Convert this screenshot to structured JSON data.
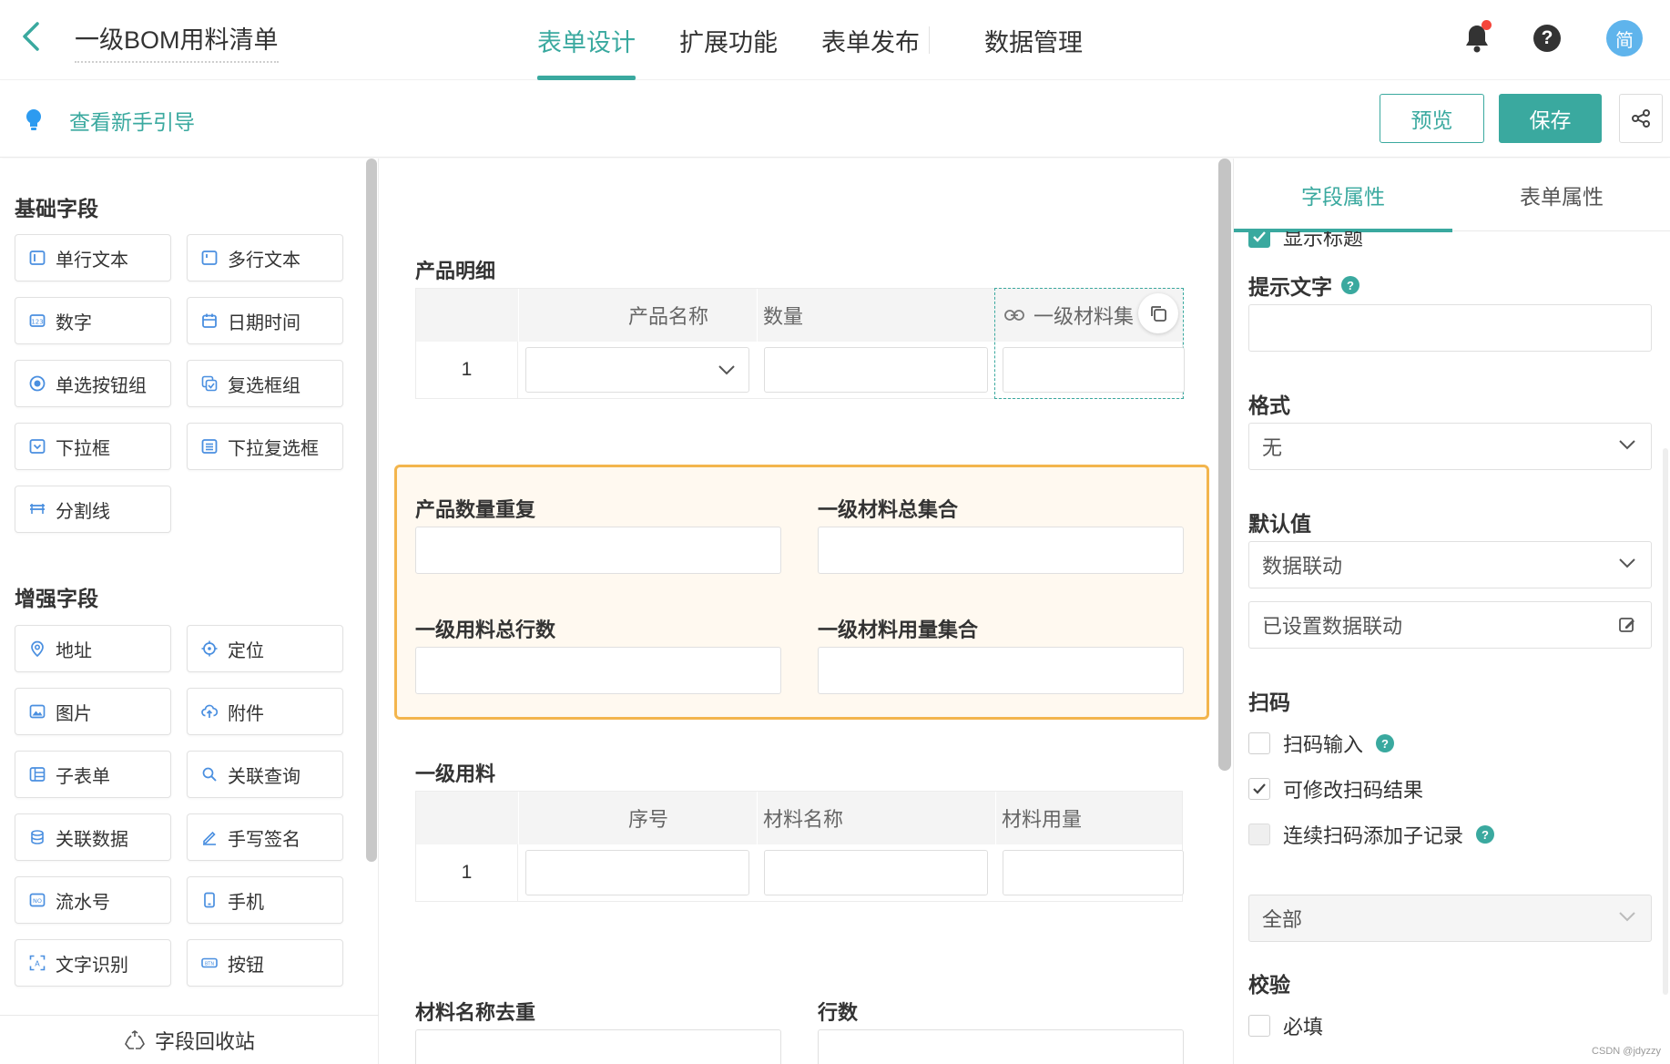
{
  "header": {
    "title": "一级BOM用料清单",
    "tabs": [
      {
        "label": "表单设计",
        "active": true
      },
      {
        "label": "扩展功能",
        "active": false
      },
      {
        "label": "表单发布",
        "active": false
      }
    ],
    "data_tab": "数据管理",
    "help_glyph": "?",
    "avatar_text": "简",
    "accent_color": "#3aa99f",
    "notification_dot_color": "#f5463b"
  },
  "subbar": {
    "guide_text": "查看新手引导",
    "preview_label": "预览",
    "save_label": "保存"
  },
  "left": {
    "basic_title": "基础字段",
    "basic_fields": [
      {
        "label": "单行文本",
        "icon": "single-line-icon"
      },
      {
        "label": "多行文本",
        "icon": "multi-line-icon"
      },
      {
        "label": "数字",
        "icon": "number-icon"
      },
      {
        "label": "日期时间",
        "icon": "calendar-icon"
      },
      {
        "label": "单选按钮组",
        "icon": "radio-icon"
      },
      {
        "label": "复选框组",
        "icon": "checkbox-group-icon"
      },
      {
        "label": "下拉框",
        "icon": "dropdown-icon"
      },
      {
        "label": "下拉复选框",
        "icon": "dropdown-multi-icon"
      },
      {
        "label": "分割线",
        "icon": "divider-icon"
      }
    ],
    "enhanced_title": "增强字段",
    "enhanced_fields": [
      {
        "label": "地址",
        "icon": "location-pin-icon"
      },
      {
        "label": "定位",
        "icon": "crosshair-icon"
      },
      {
        "label": "图片",
        "icon": "image-icon"
      },
      {
        "label": "附件",
        "icon": "upload-cloud-icon"
      },
      {
        "label": "子表单",
        "icon": "subform-icon"
      },
      {
        "label": "关联查询",
        "icon": "link-search-icon"
      },
      {
        "label": "关联数据",
        "icon": "link-data-icon"
      },
      {
        "label": "手写签名",
        "icon": "pen-icon"
      },
      {
        "label": "流水号",
        "icon": "serial-number-icon"
      },
      {
        "label": "手机",
        "icon": "phone-icon"
      },
      {
        "label": "文字识别",
        "icon": "ocr-icon"
      },
      {
        "label": "按钮",
        "icon": "button-icon"
      }
    ],
    "recycle_label": "字段回收站"
  },
  "canvas": {
    "product_detail": {
      "title": "产品明细",
      "columns": [
        "产品名称",
        "数量",
        "一级材料集"
      ],
      "row_index": "1"
    },
    "highlight_fields": [
      "产品数量重复",
      "一级材料总集合",
      "一级用料总行数",
      "一级材料用量集合"
    ],
    "material": {
      "title": "一级用料",
      "columns": [
        "序号",
        "材料名称",
        "材料用量"
      ],
      "row_index": "1"
    },
    "bottom_fields": [
      "材料名称去重",
      "行数"
    ]
  },
  "right": {
    "tabs": [
      {
        "label": "字段属性",
        "active": true
      },
      {
        "label": "表单属性",
        "active": false
      }
    ],
    "show_title_label": "显示标题",
    "hint_label": "提示文字",
    "format_label": "格式",
    "format_value": "无",
    "default_label": "默认值",
    "default_value": "数据联动",
    "linkage_text": "已设置数据联动",
    "scan_label": "扫码",
    "scan_options": [
      {
        "label": "扫码输入",
        "checked": false,
        "help": true
      },
      {
        "label": "可修改扫码结果",
        "checked": true,
        "help": false
      },
      {
        "label": "连续扫码添加子记录",
        "checked": false,
        "disabled": true,
        "help": true
      }
    ],
    "scan_scope": "全部",
    "validate_label": "校验",
    "required_label": "必填"
  },
  "watermark": "CSDN @jdyzzy"
}
